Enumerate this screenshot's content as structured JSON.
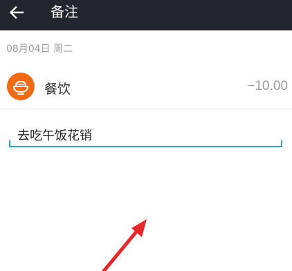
{
  "header": {
    "title": "备注",
    "back_icon": "arrow-left-icon"
  },
  "record": {
    "date": "08月04日 周二",
    "category": "餐饮",
    "category_icon": "rice-bowl-icon",
    "category_color": "#f26a14",
    "amount": "−10.00"
  },
  "note": {
    "value": "去吃午饭花销"
  },
  "colors": {
    "header_bg": "#21262f",
    "input_underline": "#2aa1c9",
    "annotation_arrow": "#e8272b"
  }
}
